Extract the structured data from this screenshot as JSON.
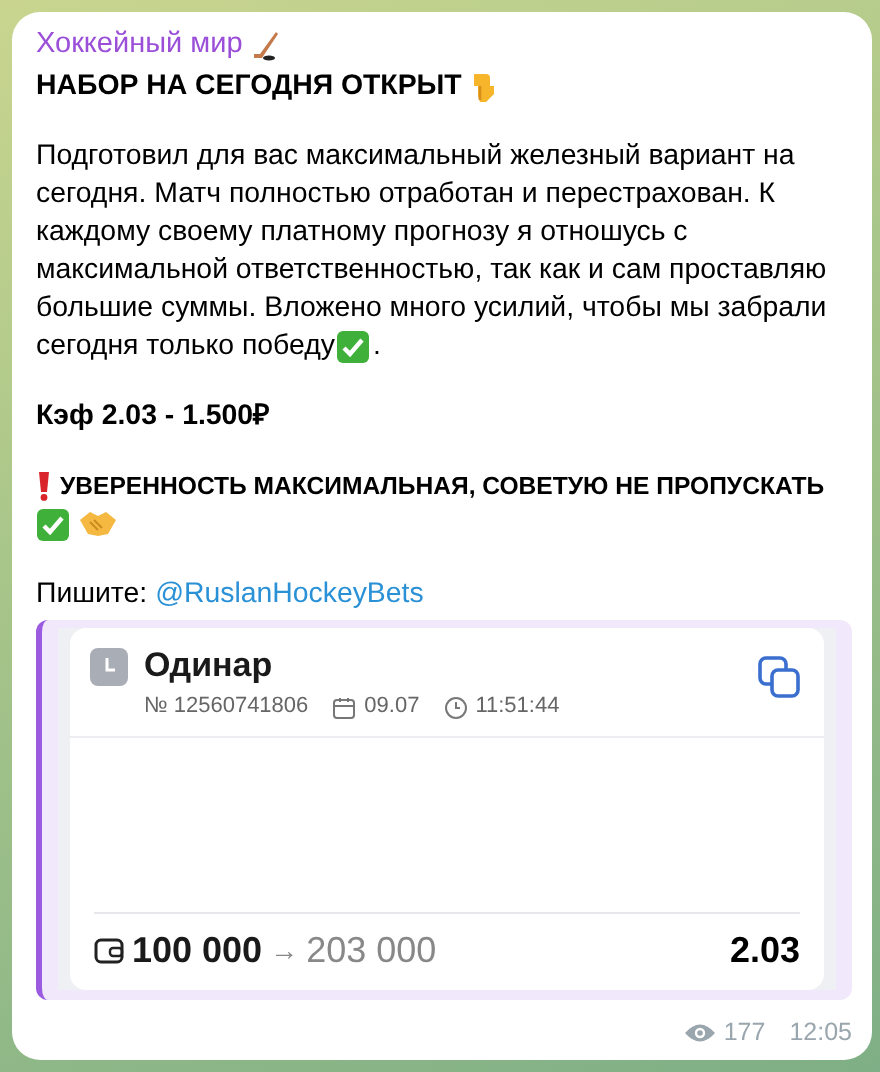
{
  "channel": {
    "name": "Хоккейный мир"
  },
  "headline": "НАБОР НА СЕГОДНЯ ОТКРЫТ",
  "body": {
    "text": "Подготовил для вас максимальный железный вариант на сегодня. Матч полностью отработан и перестрахован. К каждому своему платному прогнозу я отношусь с максимальной ответственностью, так как и сам проставляю большие суммы. Вложено много усилий, чтобы мы забрали",
    "last_line": "сегодня только победу",
    "tail": "."
  },
  "odds_line": "Кэф 2.03 - 1.500₽",
  "warning": "УВЕРЕННОСТЬ МАКСИМАЛЬНАЯ, СОВЕТУЮ НЕ ПРОПУСКАТЬ",
  "contact": {
    "label": "Пишите:",
    "link": "@RuslanHockeyBets"
  },
  "bet_card": {
    "type": "Одинар",
    "number": "№ 12560741806",
    "date": "09.07",
    "time": "11:51:44",
    "stake": "100 000",
    "arrow": "→",
    "payout": "203 000",
    "odds": "2.03"
  },
  "footer": {
    "views": "177",
    "time": "12:05"
  }
}
